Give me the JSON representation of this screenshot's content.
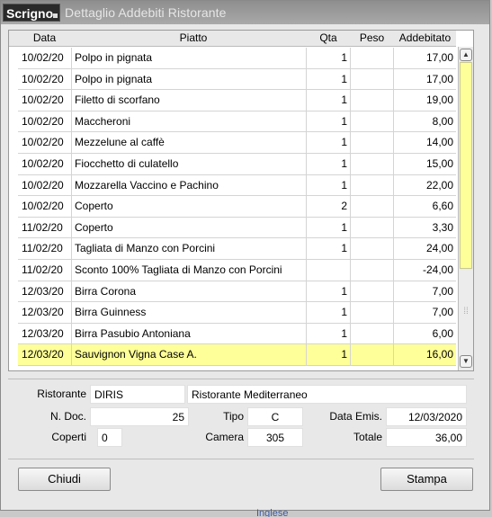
{
  "window": {
    "logo": "Scrigno",
    "title": "Dettaglio Addebiti Ristorante"
  },
  "table": {
    "columns": [
      "Data",
      "Piatto",
      "Qta",
      "Peso",
      "Addebitato"
    ],
    "rows": [
      {
        "data": "10/02/20",
        "piatto": "Polpo in pignata",
        "qta": "1",
        "peso": "",
        "addebitato": "17,00"
      },
      {
        "data": "10/02/20",
        "piatto": "Polpo in pignata",
        "qta": "1",
        "peso": "",
        "addebitato": "17,00"
      },
      {
        "data": "10/02/20",
        "piatto": "Filetto di scorfano",
        "qta": "1",
        "peso": "",
        "addebitato": "19,00"
      },
      {
        "data": "10/02/20",
        "piatto": "Maccheroni",
        "qta": "1",
        "peso": "",
        "addebitato": "8,00"
      },
      {
        "data": "10/02/20",
        "piatto": "Mezzelune al caffè",
        "qta": "1",
        "peso": "",
        "addebitato": "14,00"
      },
      {
        "data": "10/02/20",
        "piatto": "Fiocchetto di culatello",
        "qta": "1",
        "peso": "",
        "addebitato": "15,00"
      },
      {
        "data": "10/02/20",
        "piatto": "Mozzarella Vaccino e Pachino",
        "qta": "1",
        "peso": "",
        "addebitato": "22,00"
      },
      {
        "data": "10/02/20",
        "piatto": "Coperto",
        "qta": "2",
        "peso": "",
        "addebitato": "6,60"
      },
      {
        "data": "11/02/20",
        "piatto": "Coperto",
        "qta": "1",
        "peso": "",
        "addebitato": "3,30"
      },
      {
        "data": "11/02/20",
        "piatto": "Tagliata di Manzo con Porcini",
        "qta": "1",
        "peso": "",
        "addebitato": "24,00"
      },
      {
        "data": "11/02/20",
        "piatto": "Sconto 100% Tagliata di Manzo con Porcini",
        "qta": "",
        "peso": "",
        "addebitato": "-24,00"
      },
      {
        "data": "12/03/20",
        "piatto": "Birra Corona",
        "qta": "1",
        "peso": "",
        "addebitato": "7,00"
      },
      {
        "data": "12/03/20",
        "piatto": "Birra Guinness",
        "qta": "1",
        "peso": "",
        "addebitato": "7,00"
      },
      {
        "data": "12/03/20",
        "piatto": "Birra Pasubio Antoniana",
        "qta": "1",
        "peso": "",
        "addebitato": "6,00"
      },
      {
        "data": "12/03/20",
        "piatto": "Sauvignon Vigna Case A.",
        "qta": "1",
        "peso": "",
        "addebitato": "16,00"
      }
    ],
    "selected_index": 14
  },
  "scrollbar": {
    "up": "▲",
    "down": "▼",
    "grip": "⁞⁞"
  },
  "form": {
    "ristorante_label": "Ristorante",
    "ristorante_code": "DIRIS",
    "ristorante_name": "Ristorante Mediterraneo",
    "ndoc_label": "N. Doc.",
    "ndoc_value": "25",
    "tipo_label": "Tipo",
    "tipo_value": "C",
    "data_emis_label": "Data Emis.",
    "data_emis_value": "12/03/2020",
    "coperti_label": "Coperti",
    "coperti_value": "0",
    "camera_label": "Camera",
    "camera_value": "305",
    "totale_label": "Totale",
    "totale_value": "36,00"
  },
  "buttons": {
    "chiudi": "Chiudi",
    "stampa": "Stampa"
  },
  "background_text": "Inglese",
  "colors": {
    "selected_row": "#ffff99",
    "title_text": "#e6e6e6"
  }
}
